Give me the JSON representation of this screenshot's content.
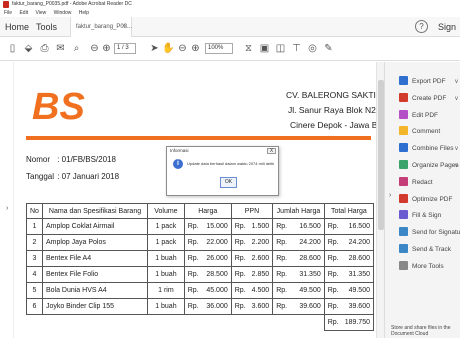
{
  "window": {
    "title": "faktur_barang_P0035.pdf - Adobe Acrobat Reader DC"
  },
  "menu": [
    "File",
    "Edit",
    "View",
    "Window",
    "Help"
  ],
  "tabs": {
    "home": "Home",
    "tools": "Tools",
    "doc": "faktur_barang_P03...",
    "sign": "Sign",
    "help": "?"
  },
  "toolbar": {
    "page": "1 / 3",
    "zoom": "100%"
  },
  "company": {
    "name": "CV. BALERONG SAKTI",
    "address1": "Jl. Sanur Raya Blok N2/19",
    "address2": "Cinere Depok - Jawa Barat"
  },
  "meta": {
    "nomor_label": "Nomor",
    "nomor": ": 01/FB/BS/2018",
    "tanggal_label": "Tanggal",
    "tanggal": ": 07 Januari 2018"
  },
  "table": {
    "headers": [
      "No",
      "Nama dan Spesifikasi Barang",
      "Volume",
      "Harga",
      "PPN",
      "Jumlah Harga",
      "Total Harga"
    ],
    "currency": "Rp.",
    "rows": [
      {
        "no": "1",
        "name": "Amplop Coklat Airmail",
        "volume": "1 pack",
        "harga": "15.000",
        "ppn": "1.500",
        "jumlah": "16.500",
        "total": "16.500"
      },
      {
        "no": "2",
        "name": "Amplop Jaya Polos",
        "volume": "1 pack",
        "harga": "22.000",
        "ppn": "2.200",
        "jumlah": "24.200",
        "total": "24.200"
      },
      {
        "no": "3",
        "name": "Bentex File A4",
        "volume": "1 buah",
        "harga": "26.000",
        "ppn": "2.600",
        "jumlah": "28.600",
        "total": "28.600"
      },
      {
        "no": "4",
        "name": "Bentex File Folio",
        "volume": "1 buah",
        "harga": "28.500",
        "ppn": "2.850",
        "jumlah": "31.350",
        "total": "31.350"
      },
      {
        "no": "5",
        "name": "Bola Dunia HVS A4",
        "volume": "1 rim",
        "harga": "45.000",
        "ppn": "4.500",
        "jumlah": "49.500",
        "total": "49.500"
      },
      {
        "no": "6",
        "name": "Joyko Binder Clip 155",
        "volume": "1 buah",
        "harga": "36.000",
        "ppn": "3.600",
        "jumlah": "39.600",
        "total": "39.600"
      }
    ],
    "grand_total": "189.750"
  },
  "dialog": {
    "title": "Informasi",
    "message": "Update data berhasil dalam waktu 2074 mili detik",
    "ok": "OK",
    "close": "X"
  },
  "right_panel": {
    "items": [
      {
        "label": "Export PDF",
        "icon": "export-pdf-icon",
        "color": "#2f6fd0",
        "arrow": "v"
      },
      {
        "label": "Create PDF",
        "icon": "create-pdf-icon",
        "color": "#d23a2e",
        "arrow": "v"
      },
      {
        "label": "Edit PDF",
        "icon": "edit-pdf-icon",
        "color": "#b44fc6",
        "arrow": ""
      },
      {
        "label": "Comment",
        "icon": "comment-icon",
        "color": "#f3b62a",
        "arrow": ""
      },
      {
        "label": "Combine Files",
        "icon": "combine-files-icon",
        "color": "#2f6fd0",
        "arrow": "v"
      },
      {
        "label": "Organize Pages",
        "icon": "organize-pages-icon",
        "color": "#3aa36a",
        "arrow": "v"
      },
      {
        "label": "Redact",
        "icon": "redact-icon",
        "color": "#c43c78",
        "arrow": ""
      },
      {
        "label": "Optimize PDF",
        "icon": "optimize-pdf-icon",
        "color": "#d23a2e",
        "arrow": ""
      },
      {
        "label": "Fill & Sign",
        "icon": "fill-sign-icon",
        "color": "#6b5bd0",
        "arrow": ""
      },
      {
        "label": "Send for Signature",
        "icon": "send-signature-icon",
        "color": "#3a86c6",
        "arrow": ""
      },
      {
        "label": "Send & Track",
        "icon": "send-track-icon",
        "color": "#3a86c6",
        "arrow": ""
      },
      {
        "label": "More Tools",
        "icon": "more-tools-icon",
        "color": "#888888",
        "arrow": ""
      }
    ],
    "footer": "Store and share files in the Document Cloud"
  },
  "colors": {
    "logo": "#f07020",
    "accent_bar": "#f07020"
  }
}
